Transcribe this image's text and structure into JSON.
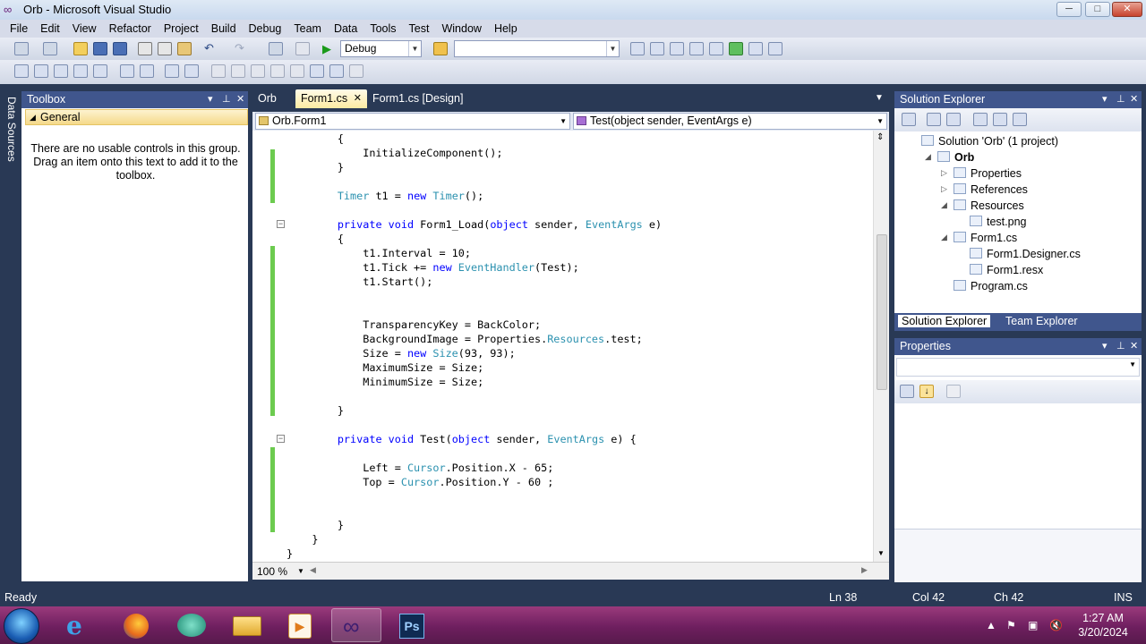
{
  "window": {
    "title": "Orb - Microsoft Visual Studio",
    "minimize": "─",
    "maximize": "□",
    "close": "✕"
  },
  "menu": [
    "File",
    "Edit",
    "View",
    "Refactor",
    "Project",
    "Build",
    "Debug",
    "Team",
    "Data",
    "Tools",
    "Test",
    "Window",
    "Help"
  ],
  "toolbar": {
    "config": "Debug",
    "platform": ""
  },
  "side_tab": "Data Sources",
  "toolbox": {
    "title": "Toolbox",
    "group": "General",
    "message": "There are no usable controls in this group. Drag an item onto this text to add it to the toolbox."
  },
  "doc_tabs": [
    {
      "label": "Orb"
    },
    {
      "label": "Form1.cs",
      "active": true
    },
    {
      "label": "Form1.cs [Design]"
    }
  ],
  "nav": {
    "class": "Orb.Form1",
    "member": "Test(object sender, EventArgs e)"
  },
  "code": [
    {
      "t": "        {"
    },
    {
      "t": "            InitializeComponent();"
    },
    {
      "t": "        }"
    },
    {
      "t": ""
    },
    {
      "t": "        Timer t1 = new Timer();"
    },
    {
      "t": ""
    },
    {
      "t": "        private void Form1_Load(object sender, EventArgs e)"
    },
    {
      "t": "        {"
    },
    {
      "t": "            t1.Interval = 10;"
    },
    {
      "t": "            t1.Tick += new EventHandler(Test);"
    },
    {
      "t": "            t1.Start();"
    },
    {
      "t": ""
    },
    {
      "t": ""
    },
    {
      "t": "            TransparencyKey = BackColor;"
    },
    {
      "t": "            BackgroundImage = Properties.Resources.test;"
    },
    {
      "t": "            Size = new Size(93, 93);"
    },
    {
      "t": "            MaximumSize = Size;"
    },
    {
      "t": "            MinimumSize = Size;"
    },
    {
      "t": ""
    },
    {
      "t": "        }"
    },
    {
      "t": ""
    },
    {
      "t": "        private void Test(object sender, EventArgs e) {"
    },
    {
      "t": ""
    },
    {
      "t": "            Left = Cursor.Position.X - 65;"
    },
    {
      "t": "            Top = Cursor.Position.Y - 60 ;"
    },
    {
      "t": ""
    },
    {
      "t": ""
    },
    {
      "t": "        }"
    },
    {
      "t": "    }"
    },
    {
      "t": "}"
    }
  ],
  "zoom": "100 %",
  "solution_explorer": {
    "title": "Solution Explorer",
    "items": [
      {
        "label": "Solution 'Orb' (1 project)",
        "level": 0
      },
      {
        "label": "Orb",
        "level": 1,
        "bold": true,
        "exp": "◢"
      },
      {
        "label": "Properties",
        "level": 2,
        "exp": "▷"
      },
      {
        "label": "References",
        "level": 2,
        "exp": "▷"
      },
      {
        "label": "Resources",
        "level": 2,
        "exp": "◢"
      },
      {
        "label": "test.png",
        "level": 3
      },
      {
        "label": "Form1.cs",
        "level": 2,
        "exp": "◢"
      },
      {
        "label": "Form1.Designer.cs",
        "level": 3
      },
      {
        "label": "Form1.resx",
        "level": 3
      },
      {
        "label": "Program.cs",
        "level": 2
      }
    ],
    "tabs": [
      "Solution Explorer",
      "Team Explorer"
    ]
  },
  "properties": {
    "title": "Properties"
  },
  "status": {
    "text": "Ready",
    "ln": "Ln 38",
    "col": "Col 42",
    "ch": "Ch 42",
    "mode": "INS"
  },
  "clock": {
    "time": "1:27 AM",
    "date": "3/20/2024"
  },
  "taskbar_apps": [
    "internet-explorer",
    "firefox",
    "chat",
    "file-explorer",
    "media-player",
    "visual-studio",
    "photoshop"
  ],
  "colors": {
    "keyword": "#0000ff",
    "type": "#2b91af",
    "chrome": "#293955",
    "change_bar": "#6ccb4f"
  }
}
